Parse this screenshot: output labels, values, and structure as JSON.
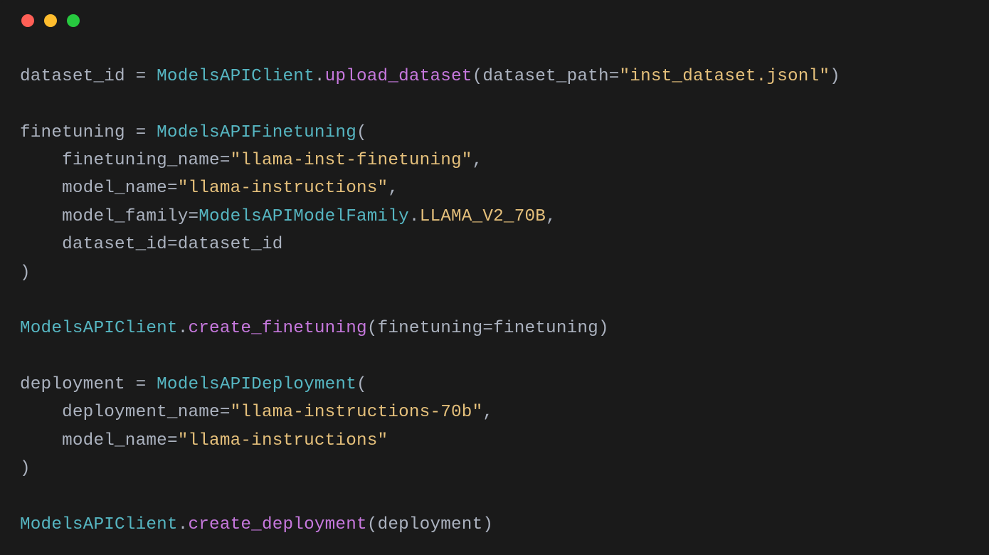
{
  "window": {
    "traffic_light_colors": {
      "close": "#ff5f56",
      "minimize": "#ffbd2e",
      "zoom": "#27c93f"
    }
  },
  "code": {
    "l1_var": "dataset_id",
    "l1_eq": " = ",
    "l1_cls": "ModelsAPIClient",
    "l1_dot": ".",
    "l1_fn": "upload_dataset",
    "l1_open": "(",
    "l1_kw": "dataset_path",
    "l1_eq2": "=",
    "l1_str": "\"inst_dataset.jsonl\"",
    "l1_close": ")",
    "l3_var": "finetuning",
    "l3_eq": " = ",
    "l3_cls": "ModelsAPIFinetuning",
    "l3_open": "(",
    "l4_indent": "    ",
    "l4_kw": "finetuning_name",
    "l4_eq": "=",
    "l4_str": "\"llama-inst-finetuning\"",
    "l4_comma": ",",
    "l5_indent": "    ",
    "l5_kw": "model_name",
    "l5_eq": "=",
    "l5_str": "\"llama-instructions\"",
    "l5_comma": ",",
    "l6_indent": "    ",
    "l6_kw": "model_family",
    "l6_eq": "=",
    "l6_cls": "ModelsAPIModelFamily",
    "l6_dot": ".",
    "l6_enum": "LLAMA_V2_70B",
    "l6_comma": ",",
    "l7_indent": "    ",
    "l7_kw": "dataset_id",
    "l7_eq": "=",
    "l7_val": "dataset_id",
    "l8_close": ")",
    "l10_cls": "ModelsAPIClient",
    "l10_dot": ".",
    "l10_fn": "create_finetuning",
    "l10_open": "(",
    "l10_kw": "finetuning",
    "l10_eq": "=",
    "l10_val": "finetuning",
    "l10_close": ")",
    "l12_var": "deployment",
    "l12_eq": " = ",
    "l12_cls": "ModelsAPIDeployment",
    "l12_open": "(",
    "l13_indent": "    ",
    "l13_kw": "deployment_name",
    "l13_eq": "=",
    "l13_str": "\"llama-instructions-70b\"",
    "l13_comma": ",",
    "l14_indent": "    ",
    "l14_kw": "model_name",
    "l14_eq": "=",
    "l14_str": "\"llama-instructions\"",
    "l15_close": ")",
    "l17_cls": "ModelsAPIClient",
    "l17_dot": ".",
    "l17_fn": "create_deployment",
    "l17_open": "(",
    "l17_val": "deployment",
    "l17_close": ")"
  }
}
